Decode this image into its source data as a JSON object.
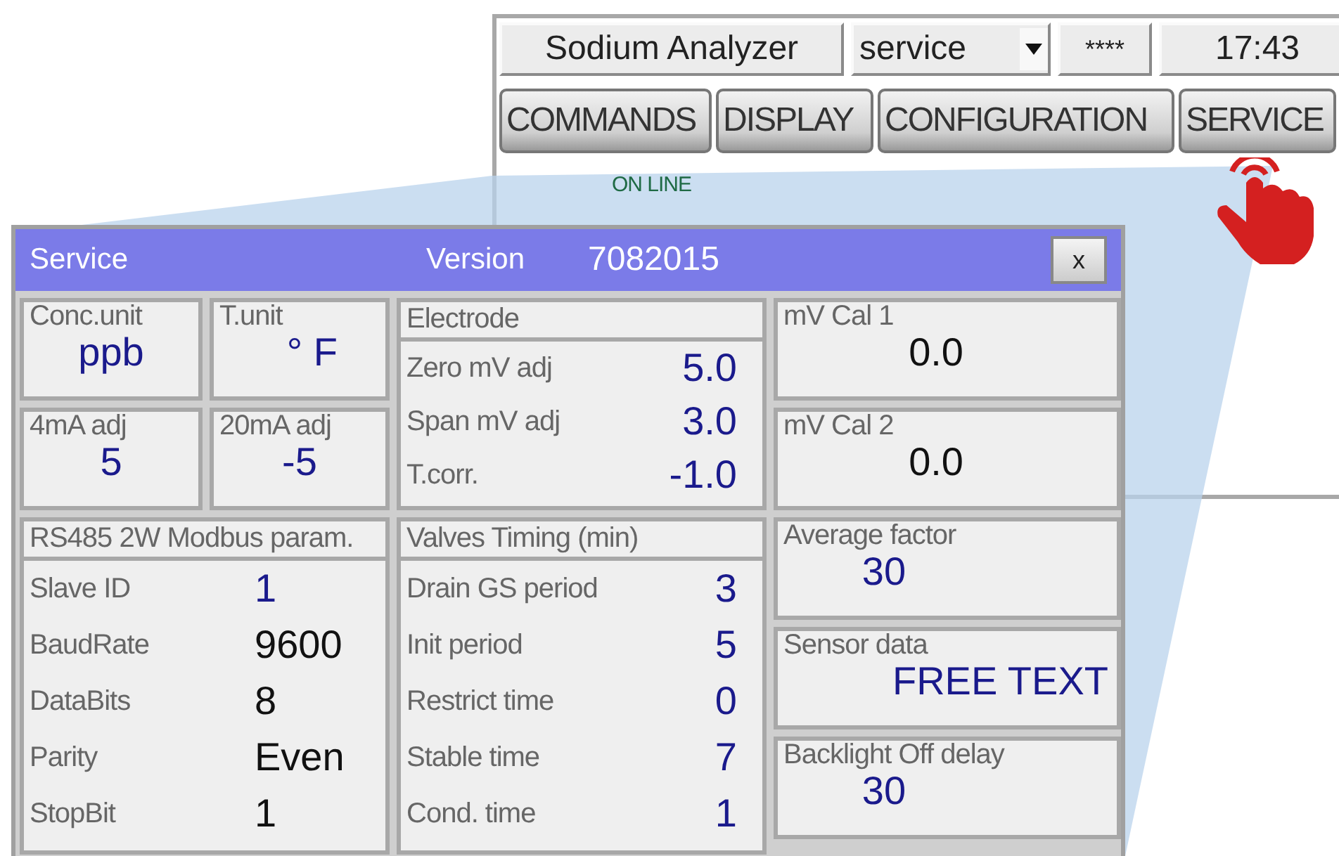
{
  "header": {
    "title": "Sodium Analyzer",
    "user": "service",
    "password": "****",
    "time": "17:43"
  },
  "tabs": [
    {
      "label": "COMMANDS"
    },
    {
      "label": "DISPLAY"
    },
    {
      "label": "CONFIGURATION"
    },
    {
      "label": "SERVICE"
    }
  ],
  "status": "ON LINE",
  "dialog": {
    "title": "Service",
    "version_label": "Version",
    "version": "7082015",
    "close": "x",
    "units": [
      {
        "label": "Conc.unit",
        "value": "ppb",
        "color": "#1a1a8c"
      },
      {
        "label": "T.unit",
        "value": "° F",
        "color": "#1a1a8c"
      },
      {
        "label": "4mA adj",
        "value": "5",
        "color": "#1a1a8c"
      },
      {
        "label": "20mA adj",
        "value": "-5",
        "color": "#1a1a8c"
      }
    ],
    "electrode": {
      "title": "Electrode",
      "fields": [
        {
          "label": "Zero mV adj",
          "value": "5.0",
          "color": "#1a1a8c"
        },
        {
          "label": "Span mV adj",
          "value": "3.0",
          "color": "#1a1a8c"
        },
        {
          "label": "T.corr.",
          "value": "-1.0",
          "color": "#1a1a8c"
        }
      ]
    },
    "modbus": {
      "title": "RS485 2W Modbus param.",
      "fields": [
        {
          "label": "Slave ID",
          "value": "1",
          "color": "#1a1a8c"
        },
        {
          "label": "BaudRate",
          "value": "9600",
          "color": "#111111"
        },
        {
          "label": "DataBits",
          "value": "8",
          "color": "#111111"
        },
        {
          "label": "Parity",
          "value": "Even",
          "color": "#111111"
        },
        {
          "label": "StopBit",
          "value": "1",
          "color": "#111111"
        }
      ]
    },
    "valves": {
      "title": "Valves Timing (min)",
      "fields": [
        {
          "label": "Drain GS period",
          "value": "3",
          "color": "#1a1a8c"
        },
        {
          "label": "Init period",
          "value": "5",
          "color": "#1a1a8c"
        },
        {
          "label": "Restrict time",
          "value": "0",
          "color": "#1a1a8c"
        },
        {
          "label": "Stable time",
          "value": "7",
          "color": "#1a1a8c"
        },
        {
          "label": "Cond. time",
          "value": "1",
          "color": "#1a1a8c"
        }
      ]
    },
    "right": [
      {
        "label": "mV Cal 1",
        "value": "0.0",
        "color": "#111111"
      },
      {
        "label": "mV Cal 2",
        "value": "0.0",
        "color": "#111111"
      },
      {
        "label": "Average factor",
        "value": "30",
        "color": "#1a1a8c"
      },
      {
        "label": "Sensor data",
        "value": "FREE TEXT",
        "color": "#1a1a8c"
      },
      {
        "label": "Backlight Off delay",
        "value": "30",
        "color": "#1a1a8c"
      }
    ]
  }
}
